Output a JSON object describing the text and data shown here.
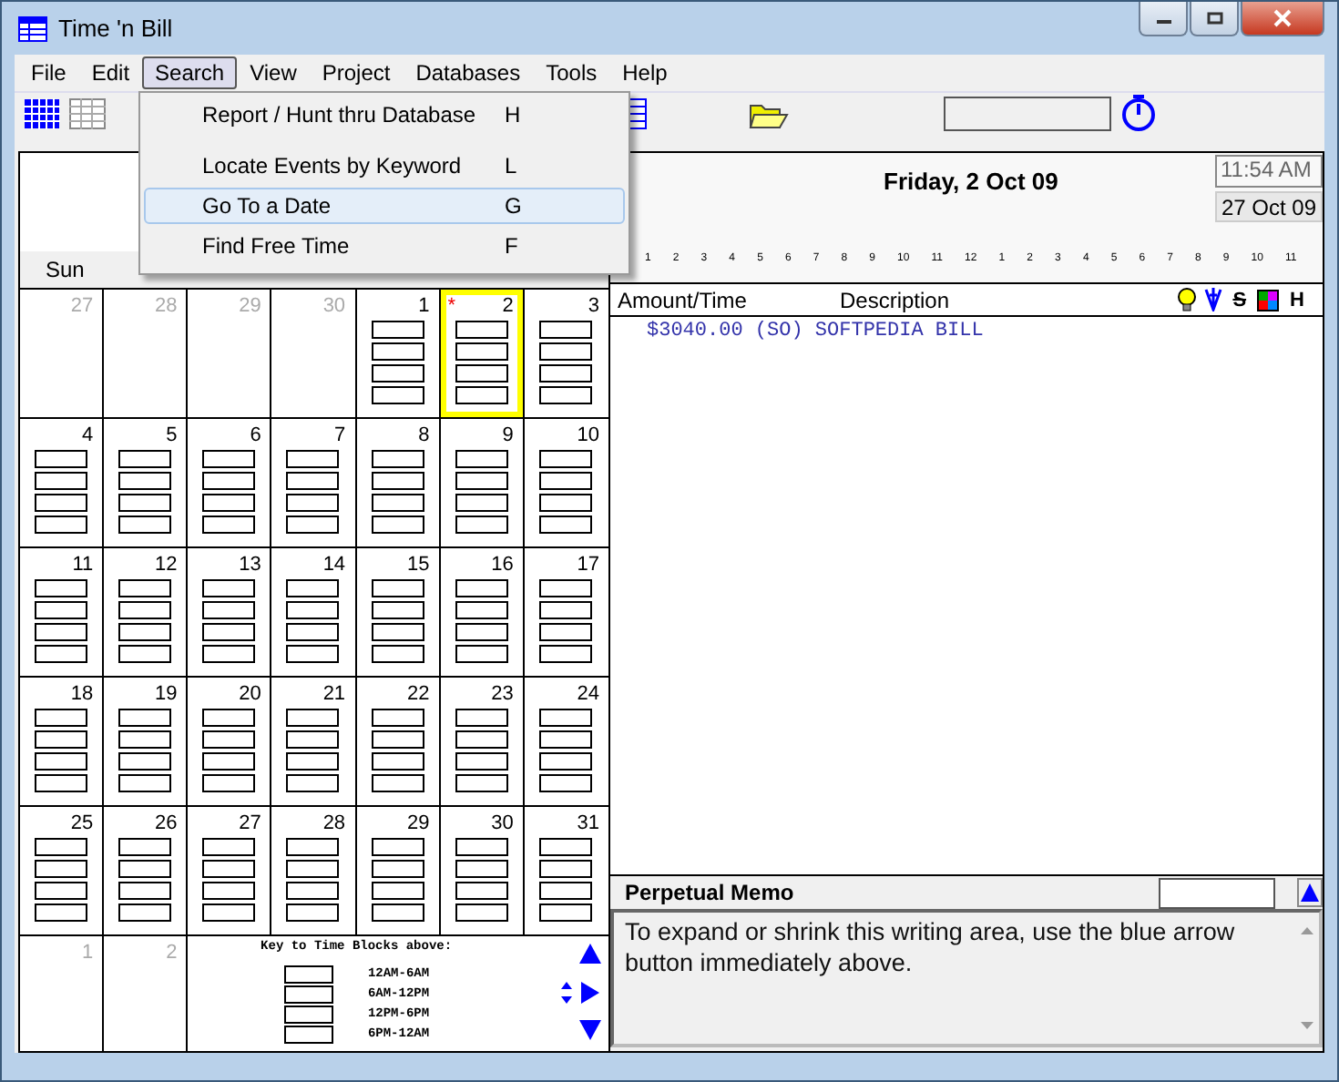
{
  "window": {
    "title": "Time 'n Bill"
  },
  "menu": [
    {
      "label": "File",
      "selected": false
    },
    {
      "label": "Edit",
      "selected": false
    },
    {
      "label": "Search",
      "selected": true
    },
    {
      "label": "View",
      "selected": false
    },
    {
      "label": "Project",
      "selected": false
    },
    {
      "label": "Databases",
      "selected": false
    },
    {
      "label": "Tools",
      "selected": false
    },
    {
      "label": "Help",
      "selected": false
    }
  ],
  "search_menu": [
    {
      "label": "Report / Hunt thru Database",
      "shortcut": "H",
      "selected": false
    },
    {
      "label": "Locate Events by Keyword",
      "shortcut": "L",
      "selected": false
    },
    {
      "label": "Go To a Date",
      "shortcut": "G",
      "selected": true
    },
    {
      "label": "Find Free Time",
      "shortcut": "F",
      "selected": false
    }
  ],
  "day_view": {
    "date": "Friday, 2 Oct 09",
    "time": "11:54 AM",
    "today_button": "27 Oct 09",
    "hours": [
      "1",
      "2",
      "3",
      "4",
      "5",
      "6",
      "7",
      "8",
      "9",
      "10",
      "11",
      "12",
      "1",
      "2",
      "3",
      "4",
      "5",
      "6",
      "7",
      "8",
      "9",
      "10",
      "11"
    ],
    "columns": [
      "Amount/Time",
      "Description"
    ],
    "flag_columns": [
      "S",
      "H"
    ],
    "entries": [
      {
        "text": "$3040.00 (SO) SOFTPEDIA BILL"
      }
    ]
  },
  "calendar": {
    "weekdays": [
      "Sun"
    ],
    "weeks": [
      [
        {
          "day": "27",
          "in_month": false,
          "selected": false
        },
        {
          "day": "28",
          "in_month": false,
          "selected": false
        },
        {
          "day": "29",
          "in_month": false,
          "selected": false
        },
        {
          "day": "30",
          "in_month": false,
          "selected": false
        },
        {
          "day": "1",
          "in_month": true,
          "selected": false
        },
        {
          "day": "2",
          "in_month": true,
          "selected": true,
          "mark": "*"
        },
        {
          "day": "3",
          "in_month": true,
          "selected": false
        }
      ],
      [
        {
          "day": "4",
          "in_month": true,
          "selected": false
        },
        {
          "day": "5",
          "in_month": true,
          "selected": false
        },
        {
          "day": "6",
          "in_month": true,
          "selected": false
        },
        {
          "day": "7",
          "in_month": true,
          "selected": false
        },
        {
          "day": "8",
          "in_month": true,
          "selected": false
        },
        {
          "day": "9",
          "in_month": true,
          "selected": false
        },
        {
          "day": "10",
          "in_month": true,
          "selected": false
        }
      ],
      [
        {
          "day": "11",
          "in_month": true,
          "selected": false
        },
        {
          "day": "12",
          "in_month": true,
          "selected": false
        },
        {
          "day": "13",
          "in_month": true,
          "selected": false
        },
        {
          "day": "14",
          "in_month": true,
          "selected": false
        },
        {
          "day": "15",
          "in_month": true,
          "selected": false
        },
        {
          "day": "16",
          "in_month": true,
          "selected": false
        },
        {
          "day": "17",
          "in_month": true,
          "selected": false
        }
      ],
      [
        {
          "day": "18",
          "in_month": true,
          "selected": false
        },
        {
          "day": "19",
          "in_month": true,
          "selected": false
        },
        {
          "day": "20",
          "in_month": true,
          "selected": false
        },
        {
          "day": "21",
          "in_month": true,
          "selected": false
        },
        {
          "day": "22",
          "in_month": true,
          "selected": false
        },
        {
          "day": "23",
          "in_month": true,
          "selected": false
        },
        {
          "day": "24",
          "in_month": true,
          "selected": false
        }
      ],
      [
        {
          "day": "25",
          "in_month": true,
          "selected": false
        },
        {
          "day": "26",
          "in_month": true,
          "selected": false
        },
        {
          "day": "27",
          "in_month": true,
          "selected": false
        },
        {
          "day": "28",
          "in_month": true,
          "selected": false
        },
        {
          "day": "29",
          "in_month": true,
          "selected": false
        },
        {
          "day": "30",
          "in_month": true,
          "selected": false
        },
        {
          "day": "31",
          "in_month": true,
          "selected": false
        }
      ],
      [
        {
          "day": "1",
          "in_month": false,
          "selected": false
        },
        {
          "day": "2",
          "in_month": false,
          "selected": false
        }
      ]
    ]
  },
  "key": {
    "title": "Key to Time Blocks above:",
    "blocks": [
      "12AM-6AM",
      "6AM-12PM",
      "12PM-6PM",
      "6PM-12AM"
    ]
  },
  "memo": {
    "title": "Perpetual Memo",
    "text": "To expand or shrink this writing area, use the blue arrow button immediately above."
  }
}
